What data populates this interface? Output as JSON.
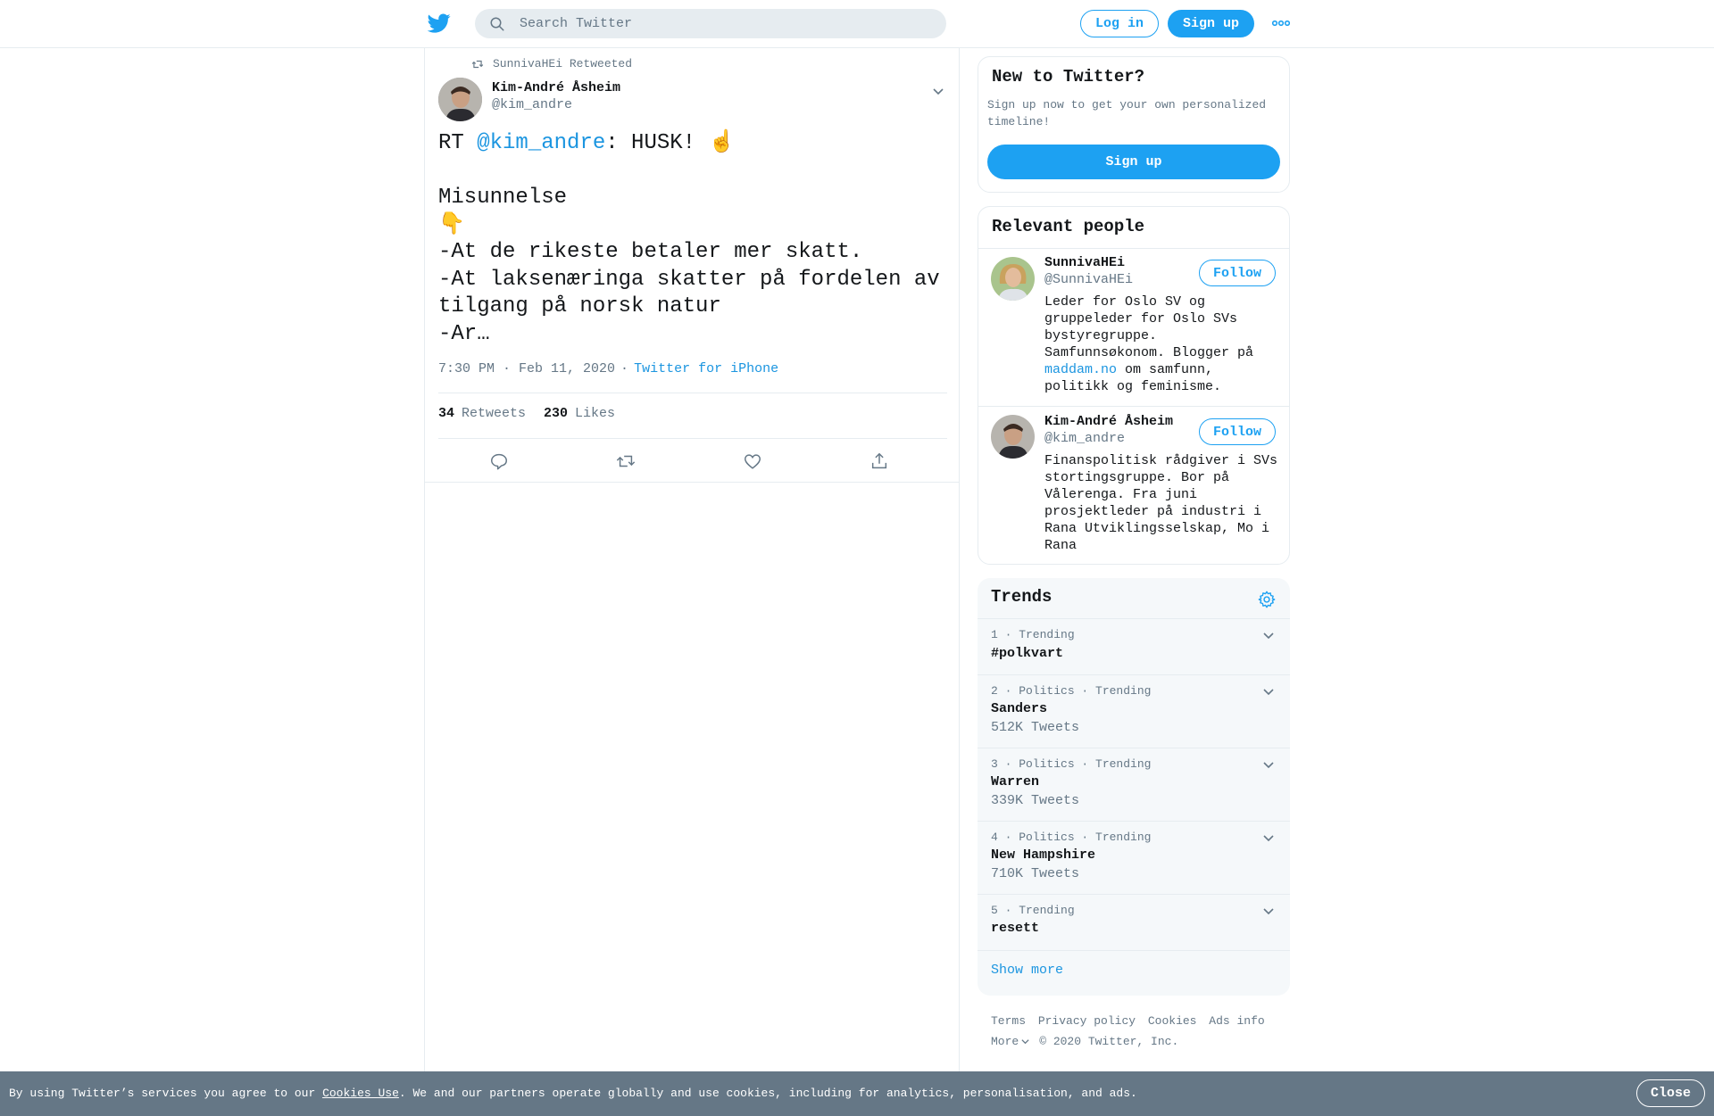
{
  "header": {
    "search_placeholder": "Search Twitter",
    "login_label": "Log in",
    "signup_label": "Sign up",
    "brand_color": "#1da1f2"
  },
  "tweet": {
    "retweeted_by": "SunnivaHEi Retweeted",
    "author_name": "Kim-André Åsheim",
    "author_handle": "@kim_andre",
    "text_prefix": "RT ",
    "text_mention": "@kim_andre",
    "text_body": ": HUSK! ☝️\n\nMisunnelse\n👇\n-At de rikeste betaler mer skatt.\n-At laksenæringa skatter på fordelen av tilgang på norsk natur\n-Ar…",
    "timestamp": "7:30 PM · Feb 11, 2020",
    "separator": "·",
    "source": "Twitter for iPhone",
    "retweets_count": "34",
    "retweets_label": "Retweets",
    "likes_count": "230",
    "likes_label": "Likes",
    "action_icons": [
      "reply-icon",
      "retweet-icon",
      "like-icon",
      "share-icon"
    ]
  },
  "sidebar": {
    "new_to_twitter": {
      "title": "New to Twitter?",
      "description": "Sign up now to get your own personalized timeline!",
      "button": "Sign up"
    },
    "relevant_people": {
      "title": "Relevant people",
      "people": [
        {
          "name": "SunnivaHEi",
          "handle": "@SunnivaHEi",
          "follow": "Follow",
          "bio_before": "Leder for Oslo SV og gruppeleder for Oslo SVs bystyregruppe. Samfunnsøkonom. Blogger på ",
          "bio_link": "maddam.no",
          "bio_after": " om samfunn, politikk og feminisme."
        },
        {
          "name": "Kim-André Åsheim",
          "handle": "@kim_andre",
          "follow": "Follow",
          "bio": "Finanspolitisk rådgiver i SVs stortingsgruppe. Bor på Vålerenga. Fra juni prosjektleder på industri i Rana Utviklingsselskap, Mo i Rana"
        }
      ]
    },
    "trends": {
      "title": "Trends",
      "items": [
        {
          "meta": "1 · Trending",
          "name": "#polkvart",
          "count": ""
        },
        {
          "meta": "2 · Politics · Trending",
          "name": "Sanders",
          "count": "512K Tweets"
        },
        {
          "meta": "3 · Politics · Trending",
          "name": "Warren",
          "count": "339K Tweets"
        },
        {
          "meta": "4 · Politics · Trending",
          "name": "New Hampshire",
          "count": "710K Tweets"
        },
        {
          "meta": "5 · Trending",
          "name": "resett",
          "count": ""
        }
      ],
      "show_more": "Show more"
    },
    "footer": {
      "links": [
        "Terms",
        "Privacy policy",
        "Cookies",
        "Ads info"
      ],
      "more": "More",
      "copyright": "© 2020 Twitter, Inc."
    }
  },
  "cookie_bar": {
    "text_before": "By using Twitter’s services you agree to our ",
    "link": "Cookies Use",
    "text_after": ". We and our partners operate globally and use cookies, including for analytics, personalisation, and ads.",
    "close": "Close"
  }
}
